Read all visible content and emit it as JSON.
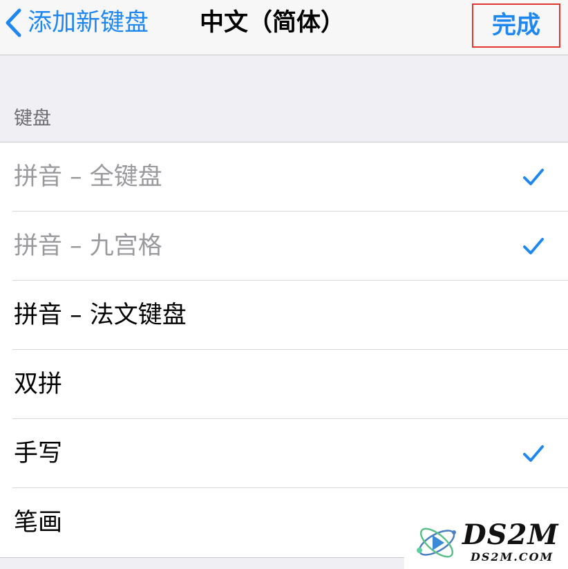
{
  "navbar": {
    "back_label": "添加新键盘",
    "title": "中文（简体）",
    "done_label": "完成"
  },
  "section": {
    "header": "键盘"
  },
  "keyboards": [
    {
      "label": "拼音 – 全键盘",
      "checked": true,
      "dimmed": true
    },
    {
      "label": "拼音 – 九宫格",
      "checked": true,
      "dimmed": true
    },
    {
      "label": "拼音 – 法文键盘",
      "checked": false,
      "dimmed": false
    },
    {
      "label": "双拼",
      "checked": false,
      "dimmed": false
    },
    {
      "label": "手写",
      "checked": true,
      "dimmed": false
    },
    {
      "label": "笔画",
      "checked": false,
      "dimmed": false
    }
  ],
  "watermark": {
    "brand": "DS2M",
    "domain": "DS2M.COM"
  },
  "colors": {
    "accent": "#1e87f0",
    "highlight_border": "#e0362d",
    "background": "#efeff4",
    "dim_text": "#9a9a9e"
  }
}
